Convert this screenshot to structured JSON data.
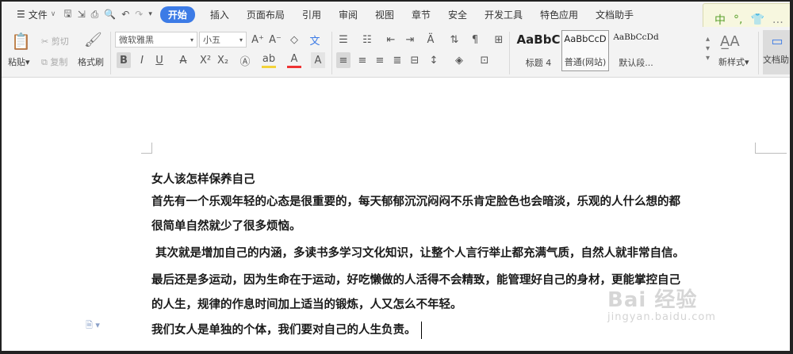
{
  "menu": {
    "file": "文件",
    "start": "开始",
    "tabs": [
      "插入",
      "页面布局",
      "引用",
      "审阅",
      "视图",
      "章节",
      "安全",
      "开发工具",
      "特色应用",
      "文档助手"
    ]
  },
  "ribbon": {
    "paste": "粘贴",
    "cut": "剪切",
    "copy": "复制",
    "format_painter": "格式刷",
    "font_name": "微软雅黑",
    "font_size": "小五",
    "styles": [
      {
        "preview": "AaBbC",
        "name": "标题 4"
      },
      {
        "preview": "AaBbCcD",
        "name": "普通(网站)"
      },
      {
        "preview": "AaBbCcDd",
        "name": "默认段..."
      }
    ],
    "new_style": "新样式",
    "doc_helper": "文档助"
  },
  "ime": {
    "label": "中"
  },
  "document": {
    "title": "女人该怎样保养自己",
    "lines": [
      "首先有一个乐观年轻的心态是很重要的，每天郁郁沉沉闷闷不乐肯定脸色也会暗淡，乐观的人什么想的都",
      "很简单自然就少了很多烦恼。",
      " 其次就是增加自己的内涵，多读书多学习文化知识，让整个人言行举止都充满气质，自然人就非常自信。",
      "最后还是多运动，因为生命在于运动，好吃懒做的人活得不会精致，能管理好自己的身材，更能掌控自己",
      "的人生，规律的作息时间加上适当的锻炼，人又怎么不年轻。",
      "我们女人是单独的个体，我们要对自己的人生负责。"
    ]
  },
  "watermark": {
    "brand": "Bai  经验",
    "url": "jingyan.baidu.com"
  }
}
